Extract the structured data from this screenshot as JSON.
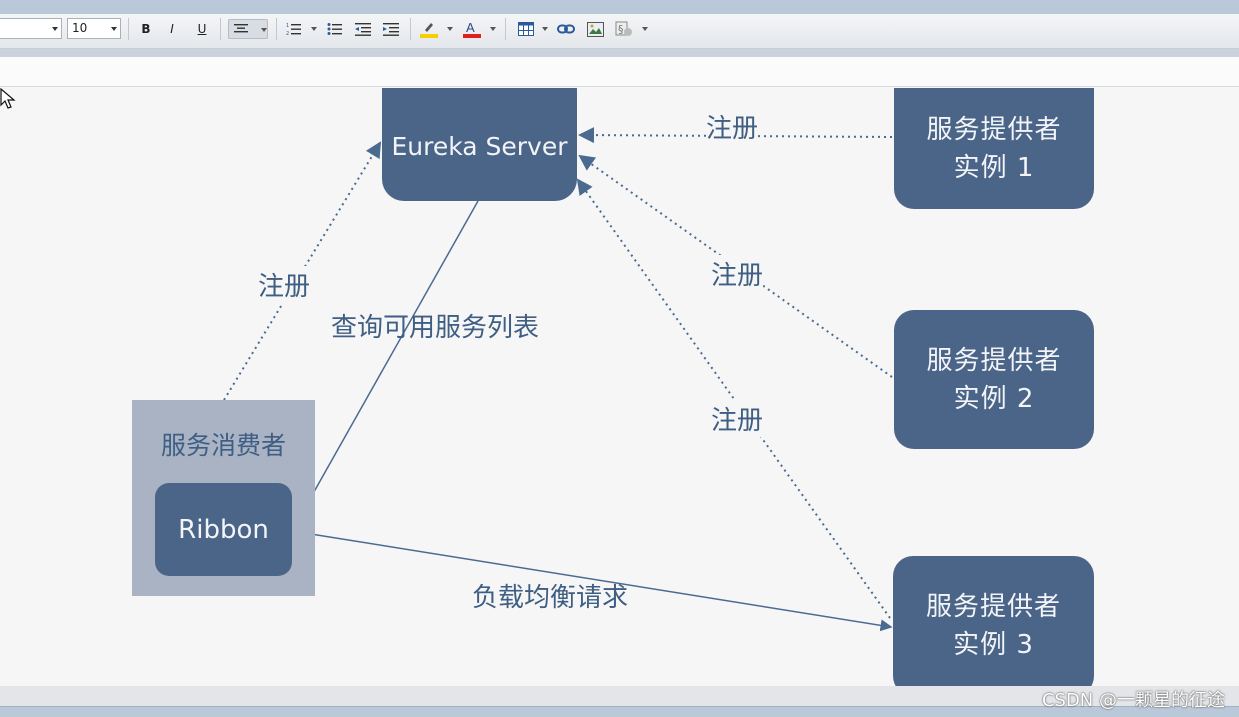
{
  "toolbar": {
    "font_name_value": "",
    "font_size_value": "10",
    "bold_label": "B",
    "italic_label": "I",
    "underline_label": "U",
    "icons": [
      "bold-icon",
      "italic-icon",
      "underline-icon",
      "align-center-icon",
      "ordered-list-icon",
      "bullet-list-icon",
      "outdent-icon",
      "indent-icon",
      "highlight-color-icon",
      "font-color-icon",
      "table-icon",
      "link-icon",
      "image-icon",
      "special-char-icon"
    ],
    "highlight_color": "#f5d000",
    "font_color": "#e02020"
  },
  "diagram": {
    "eureka_server": "Eureka Server",
    "provider_1": [
      "服务提供者",
      "实例 1"
    ],
    "provider_2": [
      "服务提供者",
      "实例 2"
    ],
    "provider_3": [
      "服务提供者",
      "实例 3"
    ],
    "consumer_label": "服务消费者",
    "ribbon": "Ribbon",
    "register_label_1": "注册",
    "register_label_2": "注册",
    "register_label_3": "注册",
    "register_label_consumer": "注册",
    "query_label": "查询可用服务列表",
    "load_balance_label": "负载均衡请求",
    "colors": {
      "node": "#4b6588",
      "text": "#3f5e83",
      "consumer_box": "#a9b3c4",
      "line": "#4a6a90"
    }
  },
  "watermark": "CSDN @一颗星的征途"
}
